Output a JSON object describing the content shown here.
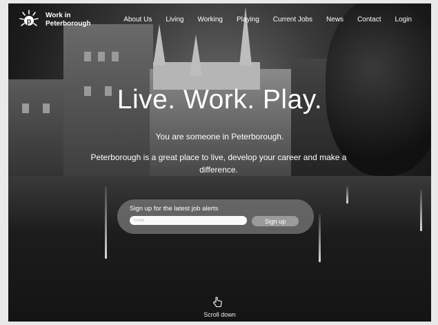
{
  "brand": {
    "line1": "Work in",
    "line2": "Peterborough",
    "logo_letter": "p"
  },
  "nav": {
    "items": [
      {
        "label": "About Us"
      },
      {
        "label": "Living"
      },
      {
        "label": "Working"
      },
      {
        "label": "Playing"
      },
      {
        "label": "Current Jobs"
      },
      {
        "label": "News"
      },
      {
        "label": "Contact"
      },
      {
        "label": "Login"
      }
    ]
  },
  "hero": {
    "headline": "Live. Work. Play.",
    "subtitle": "You are someone in Peterborough.",
    "body": "Peterborough is a great place to live, develop your career and make a difference."
  },
  "signup": {
    "label": "Sign up for the latest job alerts",
    "email_placeholder": "Email",
    "button_label": "Sign up"
  },
  "scroll": {
    "label": "Scroll down",
    "icon": "hand-pointer-down-icon"
  },
  "colors": {
    "text": "#ffffff",
    "signup_panel": "#787878",
    "button": "#9b9b9b"
  }
}
